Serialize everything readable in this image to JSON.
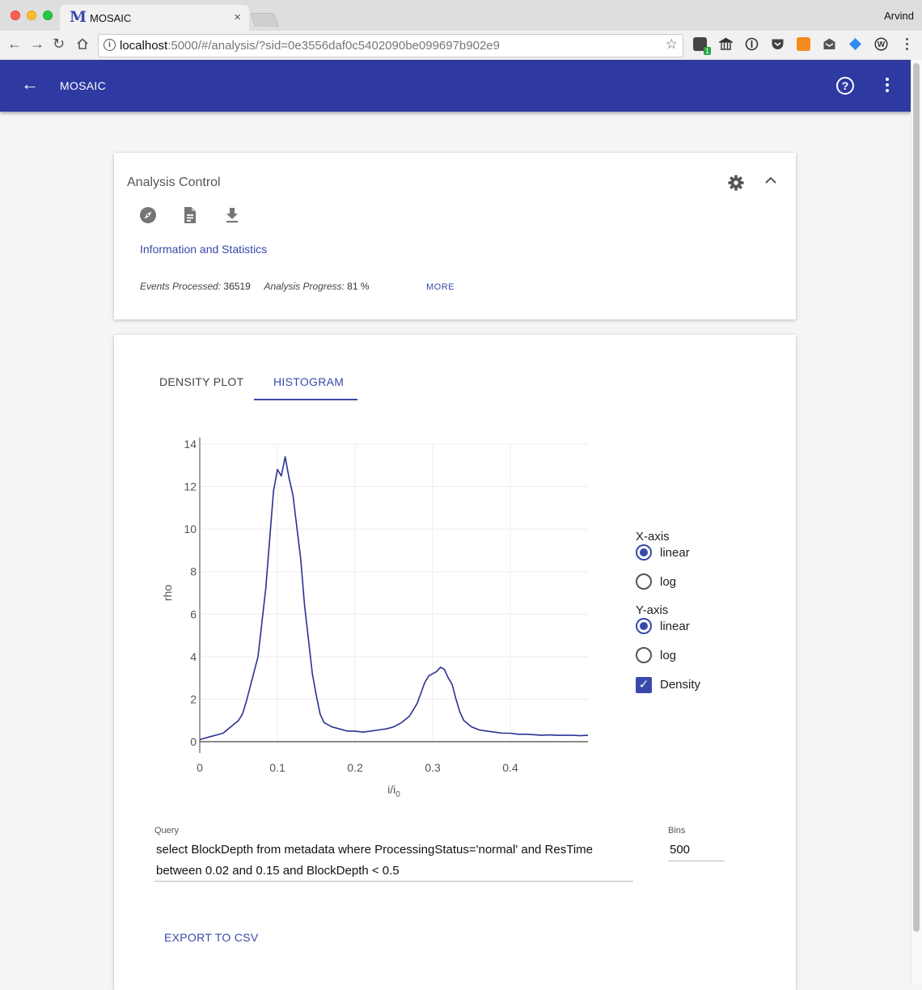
{
  "browser": {
    "tab_logo": "M",
    "tab_title": "MOSAIC",
    "tab_close": "×",
    "profile_name": "Arvind",
    "url_host": "localhost",
    "url_path": ":5000/#/analysis/?sid=0e3556daf0c5402090be099697b902e9",
    "extension_badge": "1"
  },
  "appbar": {
    "title": "MOSAIC",
    "color": "#2e3aa1"
  },
  "analysis_control": {
    "title": "Analysis Control",
    "icons": [
      "compass-icon",
      "document-icon",
      "download-icon"
    ],
    "info_link": "Information and Statistics",
    "events_label": "Events Processed:",
    "events_value": "36519",
    "progress_label": "Analysis Progress:",
    "progress_value": "81 %",
    "more_label": "MORE"
  },
  "plot_tabs": {
    "density": "DENSITY PLOT",
    "histogram": "HISTOGRAM",
    "active": "HISTOGRAM"
  },
  "chart_data": {
    "type": "line",
    "xlabel": "i/i",
    "xlabel_sub": "0",
    "ylabel": "rho",
    "xlim": [
      0,
      0.5
    ],
    "ylim": [
      0,
      14
    ],
    "x_ticks": [
      0,
      0.1,
      0.2,
      0.3,
      0.4
    ],
    "x_tick_labels": [
      "0",
      "0.1",
      "0.2",
      "0.3",
      "0.4"
    ],
    "y_ticks": [
      0,
      2,
      4,
      6,
      8,
      10,
      12,
      14
    ],
    "y_tick_labels": [
      "0",
      "2",
      "4",
      "6",
      "8",
      "10",
      "12",
      "14"
    ],
    "grid": true,
    "color": "#2a3290",
    "x": [
      0,
      0.01,
      0.02,
      0.03,
      0.04,
      0.05,
      0.055,
      0.06,
      0.065,
      0.07,
      0.075,
      0.08,
      0.085,
      0.09,
      0.095,
      0.1,
      0.105,
      0.11,
      0.115,
      0.12,
      0.125,
      0.13,
      0.135,
      0.14,
      0.145,
      0.15,
      0.155,
      0.16,
      0.17,
      0.18,
      0.19,
      0.2,
      0.21,
      0.22,
      0.23,
      0.24,
      0.25,
      0.26,
      0.27,
      0.28,
      0.285,
      0.29,
      0.295,
      0.3,
      0.305,
      0.31,
      0.315,
      0.32,
      0.325,
      0.33,
      0.335,
      0.34,
      0.35,
      0.36,
      0.37,
      0.38,
      0.39,
      0.4,
      0.41,
      0.42,
      0.43,
      0.44,
      0.45,
      0.46,
      0.47,
      0.48,
      0.49,
      0.5
    ],
    "y": [
      0.1,
      0.2,
      0.3,
      0.4,
      0.7,
      1.0,
      1.3,
      1.9,
      2.6,
      3.3,
      4.0,
      5.6,
      7.2,
      9.5,
      11.8,
      12.8,
      12.5,
      13.4,
      12.4,
      11.6,
      10.1,
      8.6,
      6.4,
      4.8,
      3.2,
      2.2,
      1.3,
      0.9,
      0.7,
      0.6,
      0.5,
      0.5,
      0.45,
      0.5,
      0.55,
      0.6,
      0.7,
      0.9,
      1.2,
      1.8,
      2.3,
      2.8,
      3.1,
      3.2,
      3.3,
      3.5,
      3.4,
      3.0,
      2.7,
      2.0,
      1.4,
      1.0,
      0.7,
      0.55,
      0.5,
      0.45,
      0.4,
      0.4,
      0.35,
      0.35,
      0.33,
      0.3,
      0.32,
      0.3,
      0.3,
      0.3,
      0.28,
      0.3
    ]
  },
  "axis_options": {
    "x_heading": "X-axis",
    "x_options": [
      "linear",
      "log"
    ],
    "x_selected": "linear",
    "y_heading": "Y-axis",
    "y_options": [
      "linear",
      "log"
    ],
    "y_selected": "linear",
    "density_label": "Density",
    "density_checked": true
  },
  "query": {
    "label": "Query",
    "value": "select BlockDepth from metadata where ProcessingStatus='normal' and ResTime between 0.02 and 0.15 and BlockDepth < 0.5"
  },
  "bins": {
    "label": "Bins",
    "value": "500"
  },
  "export_label": "EXPORT TO CSV"
}
